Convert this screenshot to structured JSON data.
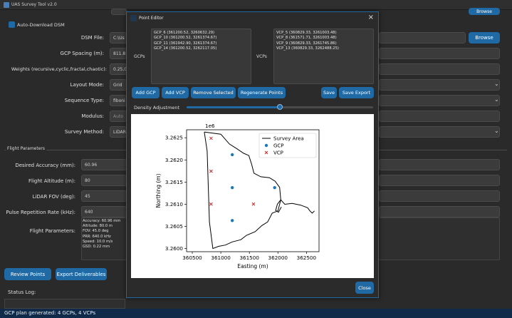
{
  "app": {
    "title": "UAS Survey Tool v2.0"
  },
  "main": {
    "auto_download_label": "Auto-Download DSM",
    "dsm_label": "DSM File:",
    "dsm_value": "C:\\Us",
    "browse_top_label": "Browse",
    "browse_label": "Browse",
    "gcp_spacing_label": "GCP Spacing (m):",
    "gcp_spacing_value": "811.8",
    "weights_label": "Weights (recursive,cyclic,fractal,chaotic):",
    "weights_value": "0.25,0",
    "layout_label": "Layout Mode:",
    "layout_value": "Grid",
    "sequence_label": "Sequence Type:",
    "sequence_value": "fiboni",
    "modulus_label": "Modulus:",
    "modulus_value": "Auto",
    "survey_label": "Survey Method:",
    "survey_value": "LiDAR",
    "flight_section": "Flight Parameters",
    "accuracy_label": "Desired Accuracy (mm):",
    "accuracy_value": "60.96",
    "altitude_label": "Flight Altitude (m):",
    "altitude_value": "80",
    "fov_label": "LiDAR FOV (deg):",
    "fov_value": "45",
    "prr_label": "Pulse Repetition Rate (kHz):",
    "prr_value": "640",
    "flight_params_label": "Flight Parameters:",
    "flight_params": [
      "Accuracy: 60.96 mm",
      "Altitude: 80.0 m",
      "FOV: 45.0 deg",
      "PRR: 640.0 kHz",
      "Speed: 10.0 m/s",
      "GSD: 0.22 mm"
    ],
    "review_points_label": "Review Points",
    "export_label": "Export Deliverables",
    "status_log_label": "Status Log:",
    "status_message": "GCP plan generated: 4 GCPs, 4 VCPs"
  },
  "dialog": {
    "title": "Point Editor",
    "gcps_label": "GCPs",
    "vcps_label": "VCPs",
    "gcps": [
      "GCP_6 (361200.52, 3260632.29)",
      "GCP_10 (361200.52, 3261374.67)",
      "GCP_11 (361942.90, 3261374.67)",
      "GCP_14 (361200.52, 3262117.05)"
    ],
    "vcps": [
      "VCP_5 (360829.33, 3261003.48)",
      "VCP_8 (361571.71, 3261003.48)",
      "VCP_9 (360829.33, 3261745.86)",
      "VCP_13 (360829.33, 3262488.25)"
    ],
    "buttons": {
      "add_gcp": "Add GCP",
      "add_vcp": "Add VCP",
      "remove_selected": "Remove Selected",
      "regenerate": "Regenerate Points",
      "save": "Save",
      "save_export": "Save Export",
      "close": "Close"
    },
    "density_label": "Density Adjustment",
    "density_value": 0.5
  },
  "chart_data": {
    "type": "scatter",
    "title": "",
    "xlabel": "Easting (m)",
    "ylabel": "Northing (m)",
    "y_offset_label": "1e6",
    "xlim": [
      360400,
      362720
    ],
    "ylim": [
      3.25993,
      3.26268
    ],
    "xticks": [
      360500,
      361000,
      361500,
      362000,
      362500
    ],
    "xtick_labels": [
      "360500",
      "361000",
      "361500",
      "362000",
      "362500"
    ],
    "yticks": [
      3.26,
      3.2605,
      3.261,
      3.2615,
      3.262,
      3.2625
    ],
    "ytick_labels": [
      "3.2600",
      "3.2605",
      "3.2610",
      "3.2615",
      "3.2620",
      "3.2625"
    ],
    "legend": [
      "Survey Area",
      "GCP",
      "VCP"
    ],
    "legend_position": "top-right",
    "grid": false,
    "colors": {
      "area": "#000000",
      "gcp": "#1f77b4",
      "vcp": "#d62728"
    },
    "survey_area": [
      [
        360710,
        3.26263
      ],
      [
        361000,
        3.26258
      ],
      [
        361150,
        3.26236
      ],
      [
        361270,
        3.26226
      ],
      [
        361400,
        3.26215
      ],
      [
        361490,
        3.2621
      ],
      [
        361540,
        3.2619
      ],
      [
        361580,
        3.2617
      ],
      [
        361700,
        3.26162
      ],
      [
        361850,
        3.2616
      ],
      [
        361950,
        3.26152
      ],
      [
        362030,
        3.26138
      ],
      [
        362050,
        3.2611
      ],
      [
        362000,
        3.26085
      ],
      [
        361900,
        3.2608
      ],
      [
        361820,
        3.2606
      ],
      [
        361720,
        3.26052
      ],
      [
        361600,
        3.26038
      ],
      [
        361450,
        3.2603
      ],
      [
        361350,
        3.2602
      ],
      [
        361200,
        3.26015
      ],
      [
        361080,
        3.26008
      ],
      [
        360960,
        3.26005
      ],
      [
        360860,
        3.26
      ],
      [
        360800,
        3.2606
      ],
      [
        360780,
        3.2614
      ],
      [
        360760,
        3.2622
      ],
      [
        360710,
        3.26263
      ]
    ],
    "road_line": [
      [
        362050,
        3.2611
      ],
      [
        362120,
        3.261
      ],
      [
        362250,
        3.26102
      ],
      [
        362400,
        3.26098
      ],
      [
        362520,
        3.26092
      ],
      [
        362560,
        3.26085
      ],
      [
        362600,
        3.2608
      ],
      [
        362640,
        3.26085
      ]
    ],
    "loop_line": [
      [
        362050,
        3.2611
      ],
      [
        361990,
        3.261
      ],
      [
        361960,
        3.26086
      ],
      [
        362010,
        3.26082
      ],
      [
        362060,
        3.26094
      ]
    ],
    "gcp": [
      {
        "x": 361200.52,
        "y": 3.26063229
      },
      {
        "x": 361200.52,
        "y": 3.26137467
      },
      {
        "x": 361942.9,
        "y": 3.26137467
      },
      {
        "x": 361200.52,
        "y": 3.26211705
      }
    ],
    "vcp": [
      {
        "x": 360829.33,
        "y": 3.26100348
      },
      {
        "x": 361571.71,
        "y": 3.26100348
      },
      {
        "x": 360829.33,
        "y": 3.26174586
      },
      {
        "x": 360829.33,
        "y": 3.26248825
      }
    ]
  }
}
